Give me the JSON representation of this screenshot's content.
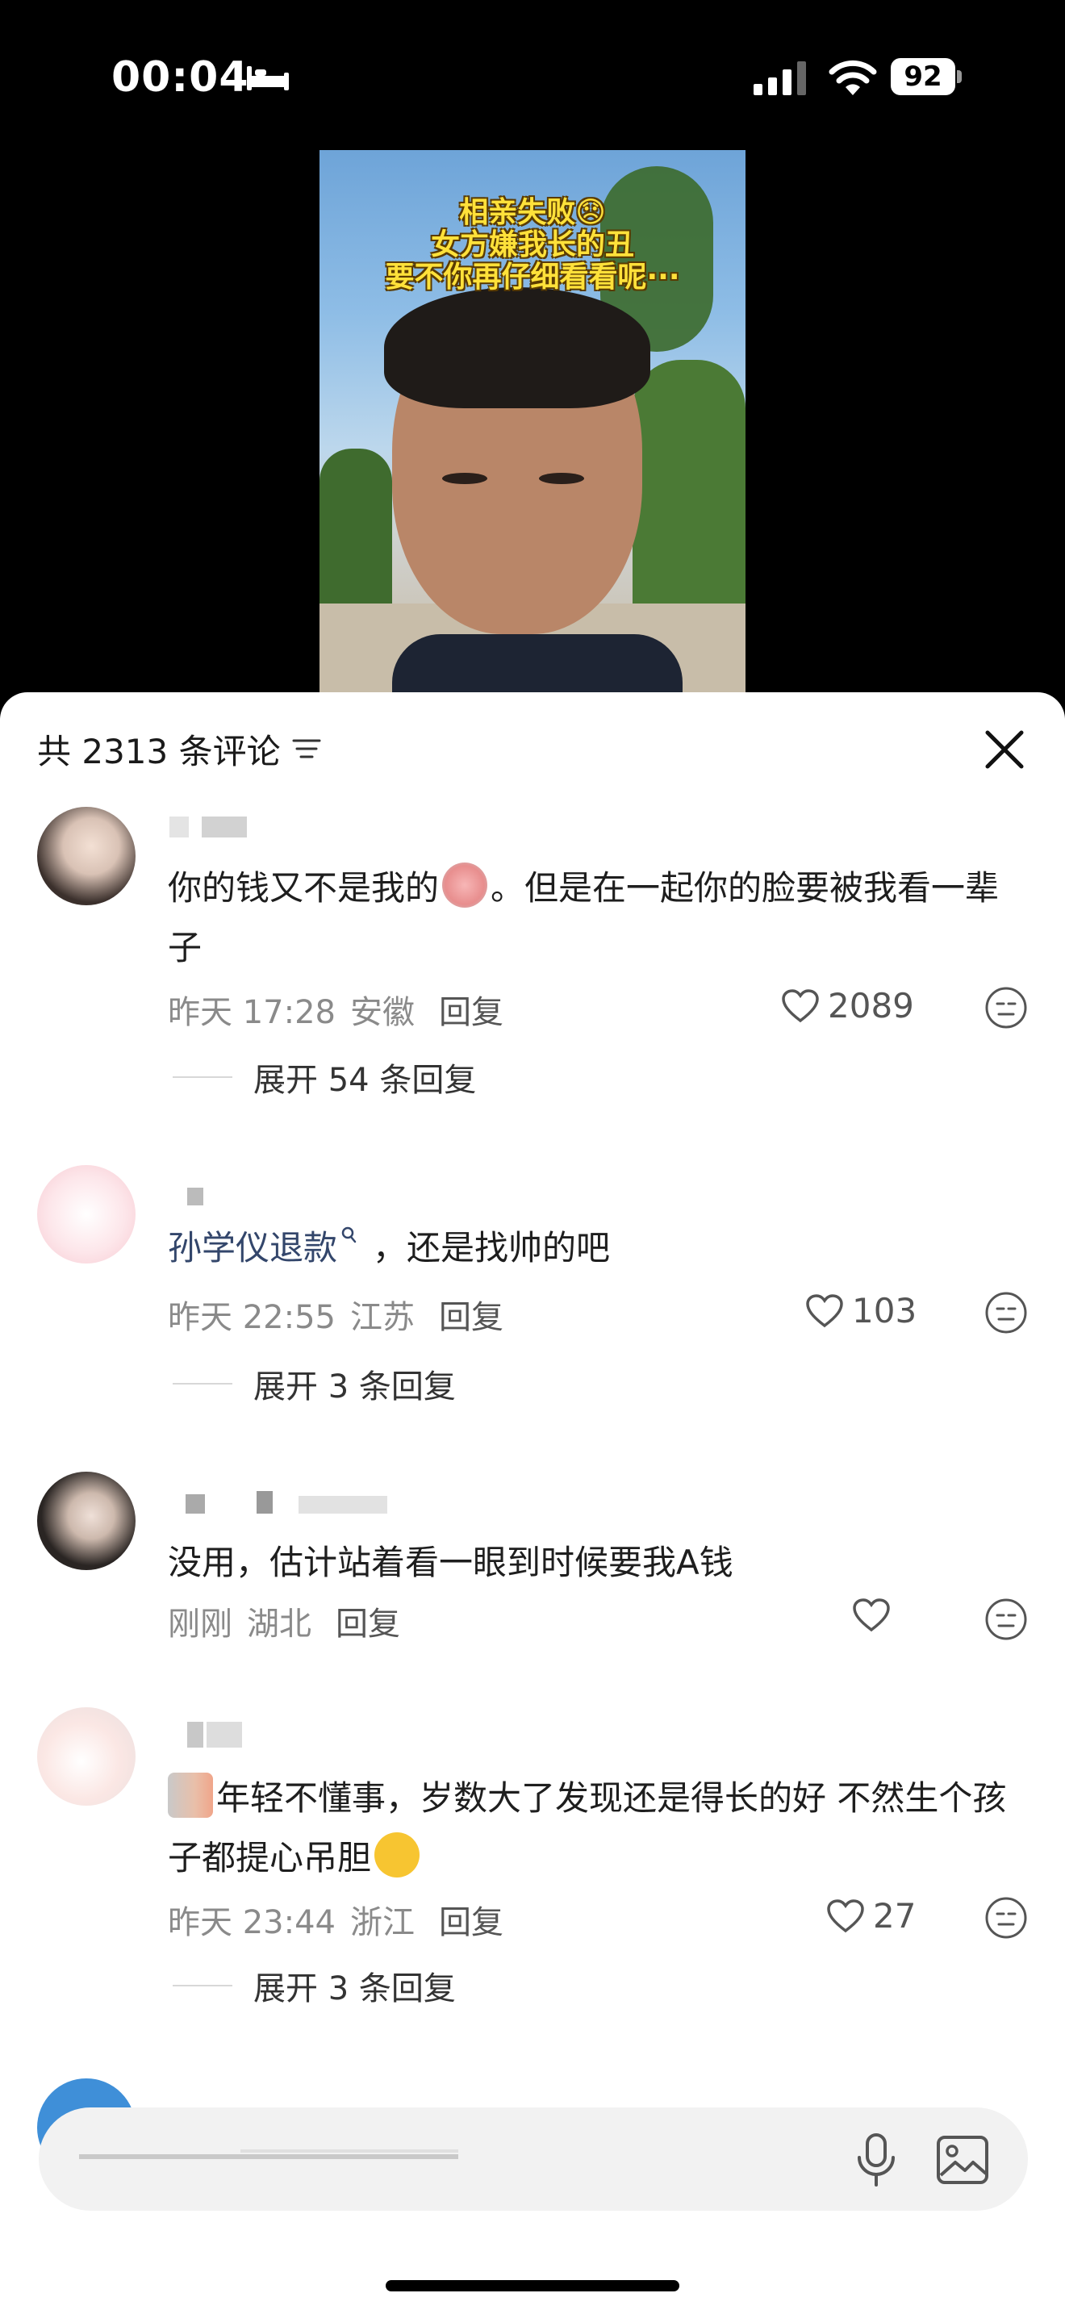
{
  "status_bar": {
    "time": "00:04",
    "battery": "92"
  },
  "video": {
    "caption_lines": [
      "相亲失败😞",
      "女方嫌我长的丑",
      "要不你再仔细看看呢···"
    ]
  },
  "comments_header": {
    "title": "共 2313 条评论"
  },
  "comments": [
    {
      "text_before": "你的钱又不是我的",
      "text_after": "。但是在一起你的脸要被我看一辈子",
      "time": "昨天 17:28",
      "location": "安徽",
      "reply_label": "回复",
      "likes": "2089",
      "expand": "展开 54 条回复"
    },
    {
      "link_text": "孙学仪退款",
      "text": "，还是找帅的吧",
      "time": "昨天 22:55",
      "location": "江苏",
      "reply_label": "回复",
      "likes": "103",
      "expand": "展开 3 条回复"
    },
    {
      "text": "没用，估计站着看一眼到时候要我A钱",
      "time": "刚刚",
      "location": "湖北",
      "reply_label": "回复",
      "likes": ""
    },
    {
      "text_before": "年轻不懂事，岁数大了发现还是得长的好 不然生个孩子都提心吊胆",
      "time": "昨天 23:44",
      "location": "浙江",
      "reply_label": "回复",
      "likes": "27",
      "expand": "展开 3 条回复"
    }
  ],
  "colors": {
    "link": "#33466b",
    "emoji_yellow": "#f7c531"
  }
}
